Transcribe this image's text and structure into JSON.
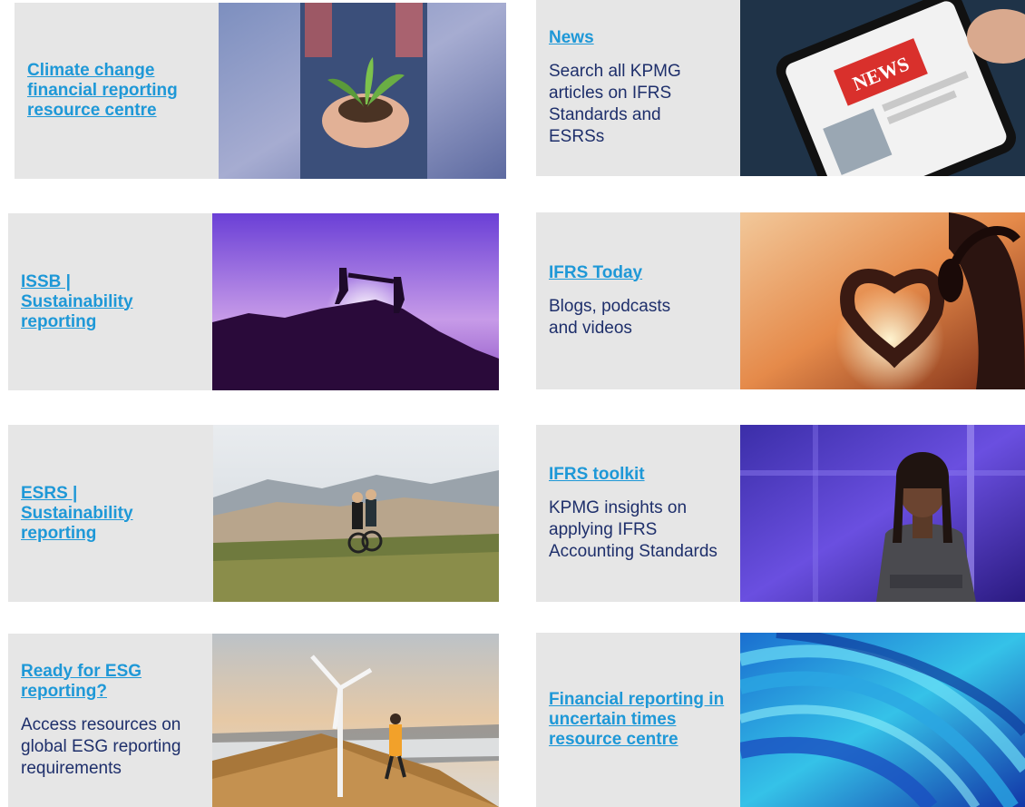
{
  "cards": [
    {
      "title": "Climate change financial reporting resource centre",
      "desc": ""
    },
    {
      "title": "News",
      "desc": "Search all KPMG articles on IFRS Standards and ESRSs"
    },
    {
      "title": "ISSB | Sustainability reporting",
      "desc": ""
    },
    {
      "title": "IFRS Today",
      "desc": "Blogs, podcasts and videos"
    },
    {
      "title": "ESRS | Sustainability reporting",
      "desc": ""
    },
    {
      "title": "IFRS toolkit",
      "desc": "KPMG insights on applying IFRS Accounting Standards"
    },
    {
      "title": "Ready for ESG reporting?",
      "desc": "Access resources on global ESG reporting requirements"
    },
    {
      "title": "Financial reporting in uncertain times resource centre",
      "desc": ""
    }
  ],
  "images": {
    "news_sign": "NEWS"
  },
  "colors": {
    "link": "#1e98d7",
    "text": "#1e2f6b",
    "panel": "#e6e6e6"
  }
}
